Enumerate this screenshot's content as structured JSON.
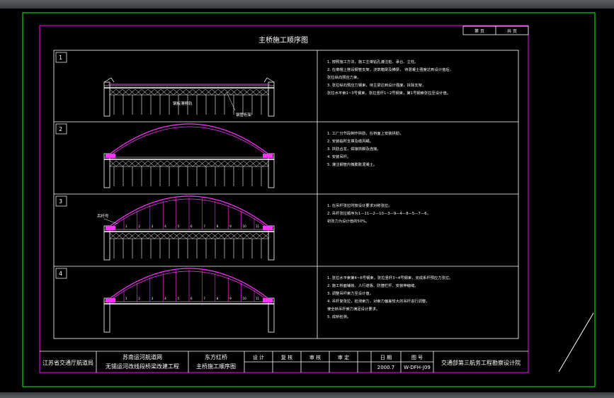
{
  "drawing": {
    "title": "主桥施工顺序图",
    "header_cells": [
      "第 页",
      "共 页"
    ],
    "colors": {
      "background": "#000000",
      "border": "#00ff00",
      "frame": "#ff00ff",
      "lines": "#ffffff",
      "arch": "#ff33ff"
    }
  },
  "stages": [
    {
      "number": "1",
      "labels": [
        "钢板滑移轨",
        "钢管桁架"
      ],
      "notes": [
        "1. 按照施工方法，施工主墩钻孔灌注桩、承台、立柱。",
        "2. 在墩帽上搭设钢管支架，浇筑箱梁及横梁，   待混凝土强度达到设计值后，",
        "   张拉纵向预应力束。",
        "3. 张拉纵向预应力钢束，待主梁达到设计强度，拆除支架，",
        "   张拉水平索1~3号钢束，张拉竖杆1~2号钢束，第1号钢索张拉至设计值。"
      ]
    },
    {
      "number": "2",
      "labels": [],
      "notes": [
        "1. 工厂分节段制作拱肋，在桥面上安装拱肋，",
        "2. 安装临时支撑及缆风绳。",
        "3. 拱肋合龙，焊接拱脚及连接。",
        "4. 安装吊杆。",
        "5. 灌注钢管内微膨胀混凝土。"
      ]
    },
    {
      "number": "3",
      "labels": [
        "吊杆号"
      ],
      "hanger_numbers": [
        "1",
        "2",
        "3",
        "4",
        "5",
        "6",
        "7",
        "8",
        "9",
        "10",
        "11"
      ],
      "notes": [
        "1. 在吊杆张拉时按设计要求对称张拉。",
        "2. 吊杆张拉顺序为1—11—2—10—3—9—4—8—5—7—6，",
        "   初张力为设计值的50%。"
      ]
    },
    {
      "number": "4",
      "labels": [],
      "hanger_numbers": [
        "1",
        "2",
        "3",
        "4",
        "5",
        "6",
        "7",
        "8",
        "9",
        "10",
        "11"
      ],
      "notes": [
        "1. 张拉水平索第4~6号钢束，张拉竖杆3~4号钢束，完成系杆预应力张拉。",
        "2. 施工桥面铺装、人行道板、防撞栏杆、安装伸缩缝。",
        "3. 调整吊杆索力至设计值。",
        "4. 吊杆复张拉，检测索力，对索力偏差较大的吊杆进行调整，",
        "   使全桥吊杆索力满足设计要求。",
        "5. 成桥检测。"
      ]
    }
  ],
  "title_block": {
    "org": "江苏省交通厅航道局",
    "project_line1": "苏南运河航道网",
    "project_line2": "无锡运河改线段桥梁改建工程",
    "drawing_line1": "东方红桥",
    "drawing_line2": "主桥施工顺序图",
    "fields": [
      "设 计",
      "复 核",
      "审 核",
      "审 定"
    ],
    "date_label": "日 期",
    "date_value": "2000.7",
    "drawing_no_label": "图 号",
    "drawing_no_value": "W-DFH-J09",
    "designer": "交通部第三航务工程勘察设计院"
  }
}
